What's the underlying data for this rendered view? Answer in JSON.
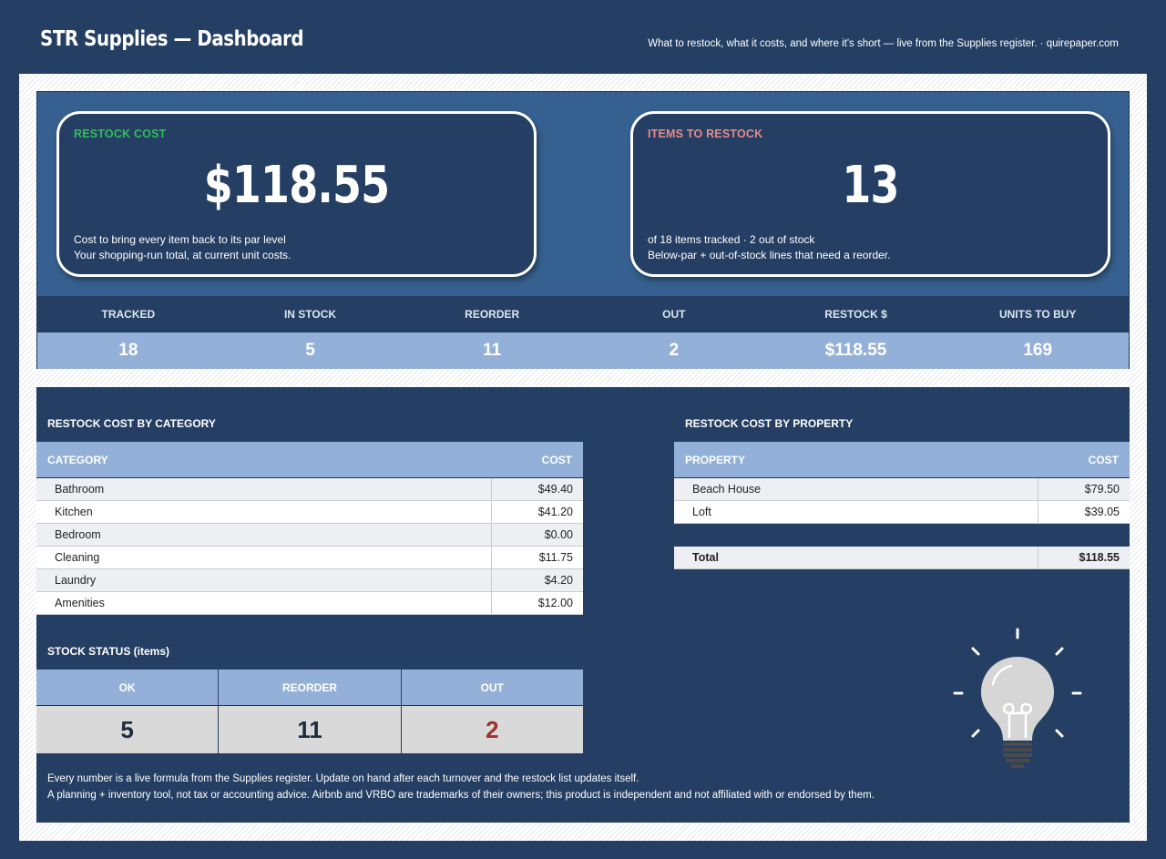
{
  "header": {
    "title": "STR Supplies — Dashboard",
    "tagline": "What to restock, what it costs, and where it's short — live from the Supplies register.  ·  quirepaper.com"
  },
  "cards": {
    "restock_cost": {
      "label": "RESTOCK COST",
      "value": "$118.55",
      "line1": "Cost to bring every  item back to its par level",
      "line2": "Your shopping-run total, at current unit costs."
    },
    "items_to_restock": {
      "label": "ITEMS TO RESTOCK",
      "value": "13",
      "line1": "of 18 items tracked  ·  2 out of stock",
      "line2": "Below-par + out-of-stock lines that need a reorder."
    }
  },
  "stats": [
    {
      "label": "TRACKED",
      "value": "18"
    },
    {
      "label": "IN STOCK",
      "value": "5"
    },
    {
      "label": "REORDER",
      "value": "11"
    },
    {
      "label": "OUT",
      "value": "2"
    },
    {
      "label": "RESTOCK $",
      "value": "$118.55"
    },
    {
      "label": "UNITS TO BUY",
      "value": "169"
    }
  ],
  "by_category": {
    "title": "RESTOCK COST BY CATEGORY",
    "col1": "CATEGORY",
    "col2": "COST",
    "rows": [
      {
        "name": "Bathroom",
        "cost": "$49.40"
      },
      {
        "name": "Kitchen",
        "cost": "$41.20"
      },
      {
        "name": "Bedroom",
        "cost": "$0.00"
      },
      {
        "name": "Cleaning",
        "cost": "$11.75"
      },
      {
        "name": "Laundry",
        "cost": "$4.20"
      },
      {
        "name": "Amenities",
        "cost": "$12.00"
      }
    ]
  },
  "by_property": {
    "title": "RESTOCK COST BY PROPERTY",
    "col1": "PROPERTY",
    "col2": "COST",
    "rows": [
      {
        "name": "Beach House",
        "cost": "$79.50"
      },
      {
        "name": "Loft",
        "cost": "$39.05"
      }
    ],
    "total_label": "Total",
    "total_value": "$118.55"
  },
  "stock_status": {
    "title": "STOCK STATUS (items)",
    "cols": [
      {
        "label": "OK",
        "value": "5"
      },
      {
        "label": "REORDER",
        "value": "11"
      },
      {
        "label": "OUT",
        "value": "2"
      }
    ]
  },
  "footnotes": {
    "line1": "Every number is a live formula from the Supplies register. Update on hand after each turnover and the restock list updates itself.",
    "line2": "A planning + inventory tool, not tax or accounting advice. Airbnb and VRBO are trademarks of their owners; this product is independent and not affiliated with or endorsed by them."
  },
  "icons": {
    "decoration": "lightbulb-icon"
  },
  "colors": {
    "navy": "#243f63",
    "mid_blue": "#36608f",
    "light_blue": "#93b1d8",
    "green_label": "#2fbf5a",
    "pink_label": "#e88a8a",
    "out_red": "#a33030"
  }
}
